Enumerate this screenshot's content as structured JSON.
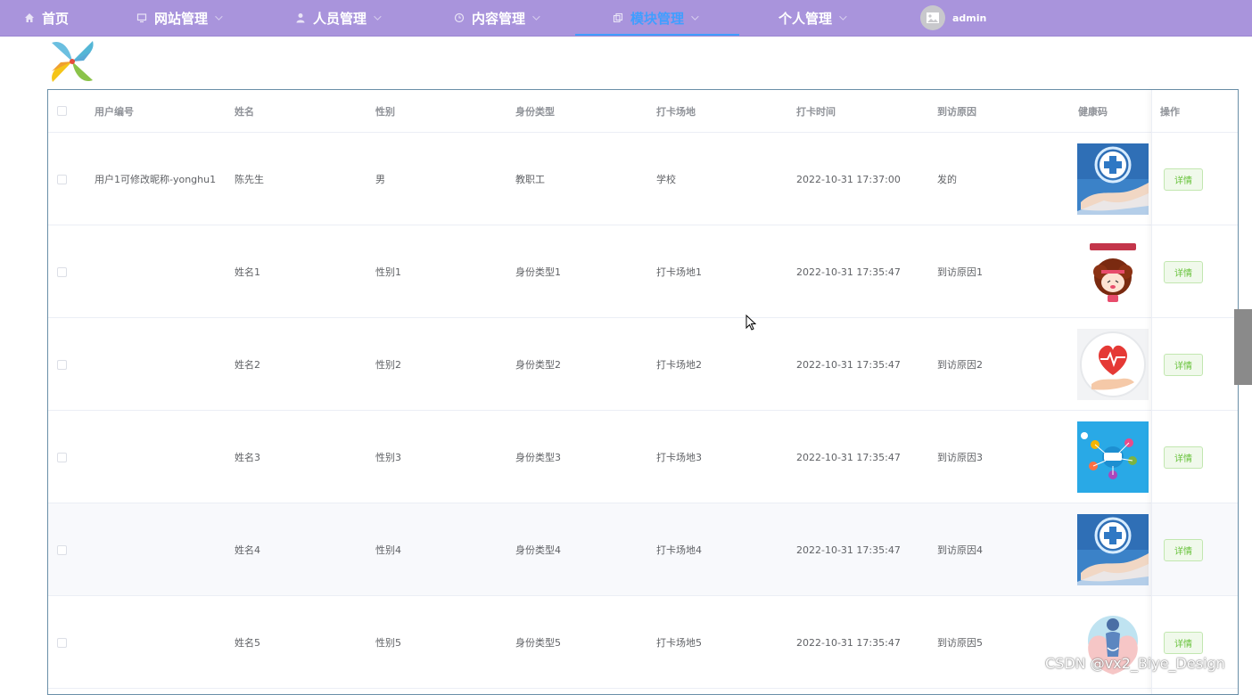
{
  "nav": {
    "items": [
      {
        "label": "首页",
        "icon": "home-icon",
        "dropdown": false,
        "active": false
      },
      {
        "label": "网站管理",
        "icon": "monitor-icon",
        "dropdown": true,
        "active": false
      },
      {
        "label": "人员管理",
        "icon": "user-icon",
        "dropdown": true,
        "active": false
      },
      {
        "label": "内容管理",
        "icon": "clock-icon",
        "dropdown": true,
        "active": false
      },
      {
        "label": "模块管理",
        "icon": "copy-icon",
        "dropdown": true,
        "active": true
      },
      {
        "label": "个人管理",
        "icon": "",
        "dropdown": true,
        "active": false
      }
    ],
    "user": {
      "name": "admin",
      "icon": "image-placeholder-icon"
    },
    "bg_color": "#a994dc",
    "active_color": "#409eff"
  },
  "logo": {
    "icon": "pinwheel-logo-icon"
  },
  "table": {
    "columns": [
      "用户编号",
      "姓名",
      "性别",
      "身份类型",
      "打卡场地",
      "打卡时间",
      "到访原因",
      "健康码",
      "操作"
    ],
    "detail_label": "详情",
    "rows": [
      {
        "user_id": "用户1可修改昵称-yonghu1",
        "name": "陈先生",
        "gender": "男",
        "identity": "教职工",
        "venue": "学校",
        "time": "2022-10-31 17:37:00",
        "reason": "发的",
        "health_code": "medical-cross-hand-image"
      },
      {
        "user_id": "",
        "name": "姓名1",
        "gender": "性别1",
        "identity": "身份类型1",
        "venue": "打卡场地1",
        "time": "2022-10-31 17:35:47",
        "reason": "到访原因1",
        "health_code": "cartoon-girl-health-image"
      },
      {
        "user_id": "",
        "name": "姓名2",
        "gender": "性别2",
        "identity": "身份类型2",
        "venue": "打卡场地2",
        "time": "2022-10-31 17:35:47",
        "reason": "到访原因2",
        "health_code": "heart-hand-image"
      },
      {
        "user_id": "",
        "name": "姓名3",
        "gender": "性别3",
        "identity": "身份类型3",
        "venue": "打卡场地3",
        "time": "2022-10-31 17:35:47",
        "reason": "到访原因3",
        "health_code": "health-icons-blue-image"
      },
      {
        "user_id": "",
        "name": "姓名4",
        "gender": "性别4",
        "identity": "身份类型4",
        "venue": "打卡场地4",
        "time": "2022-10-31 17:35:47",
        "reason": "到访原因4",
        "health_code": "medical-cross-hand-image"
      },
      {
        "user_id": "",
        "name": "姓名5",
        "gender": "性别5",
        "identity": "身份类型5",
        "venue": "打卡场地5",
        "time": "2022-10-31 17:35:47",
        "reason": "到访原因5",
        "health_code": "hands-heart-figure-image"
      }
    ]
  },
  "watermark": "CSDN @vx2_Biye_Design"
}
